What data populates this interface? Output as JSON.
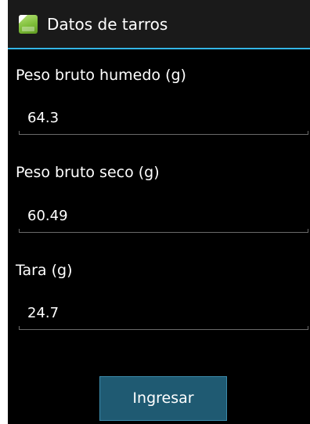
{
  "app_bar": {
    "icon": "android-app-icon",
    "title": "Datos de tarros"
  },
  "form": {
    "fields": [
      {
        "label": "Peso bruto humedo (g)",
        "value": "64.3"
      },
      {
        "label": "Peso bruto seco (g)",
        "value": "60.49"
      },
      {
        "label": "Tara (g)",
        "value": "24.7"
      }
    ],
    "submit_label": "Ingresar"
  },
  "colors": {
    "background": "#000000",
    "action_bar": "#1a1a1a",
    "accent_line": "#33b5e5",
    "button_fill": "#1f5a72",
    "button_border": "#3c8bab",
    "text": "#ffffff"
  }
}
